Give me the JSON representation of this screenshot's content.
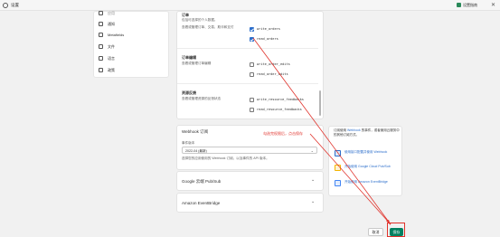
{
  "window": {
    "title": "设置",
    "badge_label": "设置指南"
  },
  "sidebar": {
    "items": [
      {
        "label": "应用"
      },
      {
        "label": "通知"
      },
      {
        "label": "Metafields"
      },
      {
        "label": "文件"
      },
      {
        "label": "语言"
      },
      {
        "label": "政策"
      }
    ]
  },
  "permissions": {
    "intro": "包括可选择的个人数据。",
    "sections": [
      {
        "title": "订单",
        "desc": "查看或管理订单、交易、欺诈和支付",
        "checkboxes": [
          {
            "label": "write_orders",
            "checked": true
          },
          {
            "label": "read_orders",
            "checked": true
          }
        ]
      },
      {
        "title": "订单编辑",
        "desc": "查看或管理订单编辑",
        "checkboxes": [
          {
            "label": "write_order_edits",
            "checked": false
          },
          {
            "label": "read_order_edits",
            "checked": false
          }
        ]
      },
      {
        "title": "资源反馈",
        "desc": "查看或管理资源的反馈状态",
        "checkboxes": [
          {
            "label": "write_resource_feedbacks",
            "checked": false
          },
          {
            "label": "read_resource_feedbacks",
            "checked": false
          }
        ]
      }
    ]
  },
  "webhook": {
    "title": "Webhook 订阅",
    "version_label": "事件版本",
    "version_value": "2022-04 (最新)",
    "hint": "选择您的应用使用的 Webhook 订阅，以及事件的 API 版本。",
    "annotation": "勾选完权限后，点击保存"
  },
  "accordions": [
    {
      "label": "Google 云端 Pub/Sub"
    },
    {
      "label": "Amazon EventBridge"
    }
  ],
  "info": {
    "text_before": "订阅使用 ",
    "text_link": "Webhook",
    "text_after": " 的事件，或者使用云服务中的其他订阅方式。",
    "links": [
      {
        "label": "使用接口配置并使用 Webhook",
        "color": "#2c6ecb"
      },
      {
        "label": "开始使用 Google Cloud Pub/Sub",
        "color": "#f4b400"
      },
      {
        "label": "开始使用 Amazon EventBridge",
        "color": "#4285f4"
      }
    ]
  },
  "footer": {
    "cancel_label": "取消",
    "save_label": "保存"
  },
  "colors": {
    "accent": "#008060",
    "annotation": "#e0322b",
    "checkbox": "#2c6ecb"
  }
}
